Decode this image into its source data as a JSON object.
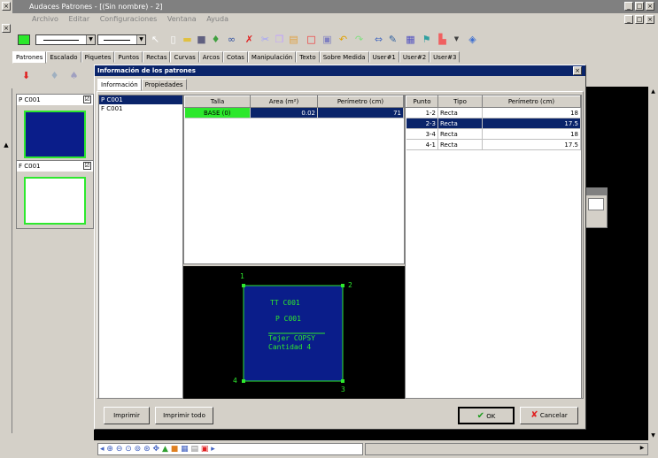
{
  "app": {
    "title": "Audaces Patrones - [(Sin nombre) - 2]"
  },
  "menu": [
    "Archivo",
    "Editar",
    "Configuraciones",
    "Ventana",
    "Ayuda"
  ],
  "tabs": [
    "Patrones",
    "Escalado",
    "Piquetes",
    "Puntos",
    "Rectas",
    "Curvas",
    "Arcos",
    "Cotas",
    "Manipulación",
    "Texto",
    "Sobre Medida",
    "User#1",
    "User#2",
    "User#3"
  ],
  "left_panel": {
    "items": [
      {
        "name": "P C001",
        "checked": "☑",
        "color": "#0a1d8a"
      },
      {
        "name": "F C001",
        "checked": "☑",
        "color": "#ffffff"
      }
    ]
  },
  "dialog": {
    "title": "Información de los patrones",
    "close": "×",
    "tabs": [
      "Información",
      "Propiedades"
    ],
    "pattern_list": [
      "P C001",
      "F C001"
    ],
    "size_table": {
      "headers": [
        "Talla",
        "Area (m²)",
        "Perímetro (cm)"
      ],
      "rows": [
        [
          "BASE (0)",
          "0.02",
          "71"
        ]
      ]
    },
    "points_table": {
      "headers": [
        "Punto",
        "Tipo",
        "Perímetro (cm)"
      ],
      "rows": [
        [
          "1-2",
          "Recta",
          "18"
        ],
        [
          "2-3",
          "Recta",
          "17.5"
        ],
        [
          "3-4",
          "Recta",
          "18"
        ],
        [
          "4-1",
          "Recta",
          "17.5"
        ]
      ]
    },
    "preview": {
      "corners": [
        "1",
        "2",
        "3",
        "4"
      ],
      "lines": [
        "TT C001",
        "P C001",
        "Tejer COPSY",
        "Cantidad 4"
      ]
    },
    "buttons": {
      "print": "Imprimir",
      "print_all": "Imprimir todo",
      "ok": "OK",
      "cancel": "Cancelar"
    }
  },
  "colors": {
    "pattern_fill": "#0a1d8a",
    "selection": "#0a246a",
    "size_cell": "#2ce82c",
    "preview_stroke": "#2ee82e"
  }
}
